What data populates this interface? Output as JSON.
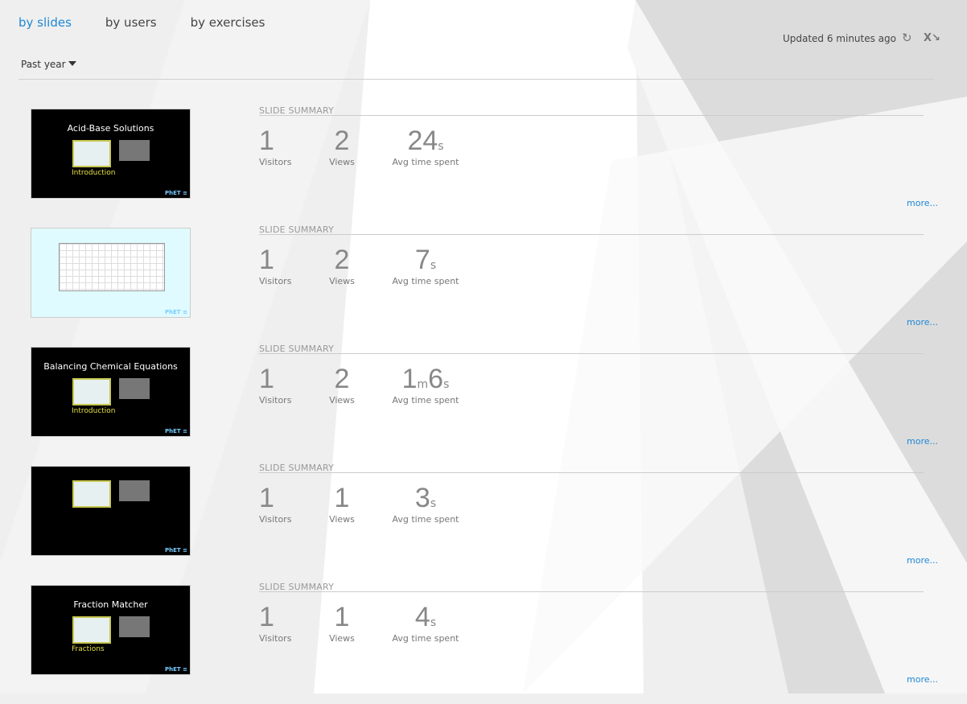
{
  "tabs": [
    {
      "label": "by slides",
      "active": true
    },
    {
      "label": "by users",
      "active": false
    },
    {
      "label": "by exercises",
      "active": false
    }
  ],
  "status": {
    "updated": "Updated 6 minutes ago",
    "refresh_icon": "refresh-icon",
    "export_icon": "excel-export-icon"
  },
  "filter": {
    "selected": "Past year"
  },
  "accent": "#1e88d6",
  "slides": [
    {
      "thumb": {
        "title": "Acid-Base Solutions",
        "label": "Introduction",
        "dark": true
      },
      "summary_label": "SLIDE SUMMARY",
      "visitors": "1",
      "visitors_label": "Visitors",
      "views": "2",
      "views_label": "Views",
      "time": [
        {
          "n": "24",
          "u": "s"
        }
      ],
      "time_label": "Avg time spent",
      "more": "more..."
    },
    {
      "thumb": {
        "title": "",
        "label": "",
        "dark": false
      },
      "summary_label": "SLIDE SUMMARY",
      "visitors": "1",
      "visitors_label": "Visitors",
      "views": "2",
      "views_label": "Views",
      "time": [
        {
          "n": "7",
          "u": "s"
        }
      ],
      "time_label": "Avg time spent",
      "more": "more..."
    },
    {
      "thumb": {
        "title": "Balancing Chemical Equations",
        "label": "Introduction",
        "dark": true
      },
      "summary_label": "SLIDE SUMMARY",
      "visitors": "1",
      "visitors_label": "Visitors",
      "views": "2",
      "views_label": "Views",
      "time": [
        {
          "n": "1",
          "u": "m"
        },
        {
          "n": "6",
          "u": "s"
        }
      ],
      "time_label": "Avg time spent",
      "more": "more..."
    },
    {
      "thumb": {
        "title": "",
        "label": "",
        "dark": true
      },
      "summary_label": "SLIDE SUMMARY",
      "visitors": "1",
      "visitors_label": "Visitors",
      "views": "1",
      "views_label": "Views",
      "time": [
        {
          "n": "3",
          "u": "s"
        }
      ],
      "time_label": "Avg time spent",
      "more": "more..."
    },
    {
      "thumb": {
        "title": "Fraction Matcher",
        "label": "Fractions",
        "dark": true
      },
      "summary_label": "SLIDE SUMMARY",
      "visitors": "1",
      "visitors_label": "Visitors",
      "views": "1",
      "views_label": "Views",
      "time": [
        {
          "n": "4",
          "u": "s"
        }
      ],
      "time_label": "Avg time spent",
      "more": "more..."
    }
  ]
}
